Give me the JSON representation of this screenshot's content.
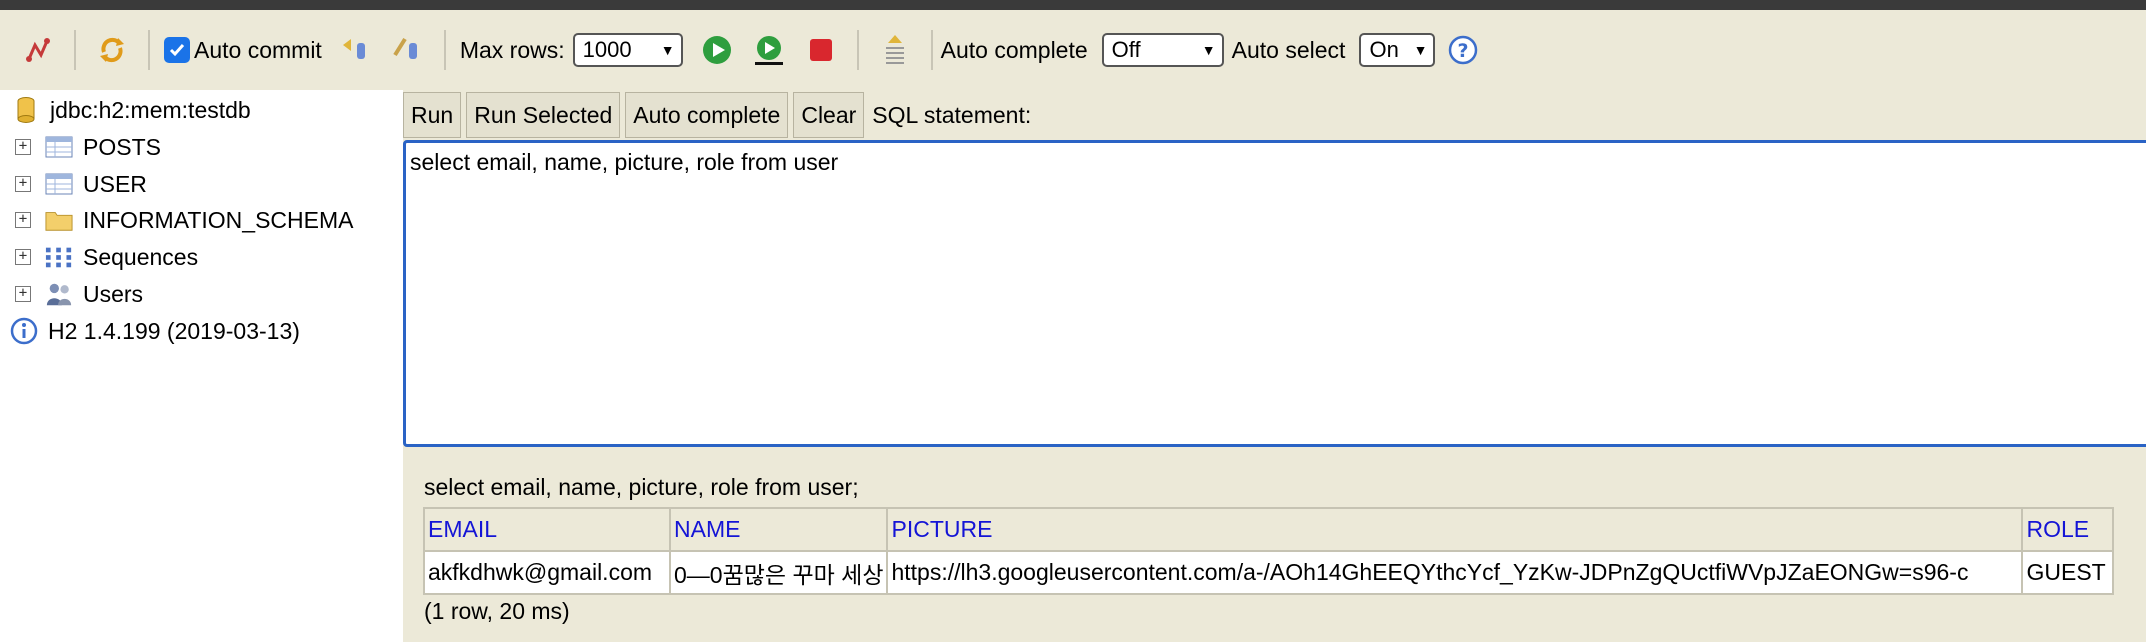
{
  "toolbar": {
    "auto_commit_label": "Auto commit",
    "max_rows_label": "Max rows:",
    "max_rows_value": "1000",
    "auto_complete_label": "Auto complete",
    "auto_complete_value": "Off",
    "auto_select_label": "Auto select",
    "auto_select_value": "On",
    "auto_commit_checked": true
  },
  "sidebar": {
    "connection": "jdbc:h2:mem:testdb",
    "items": [
      {
        "label": "POSTS",
        "icon": "table-icon"
      },
      {
        "label": "USER",
        "icon": "table-icon"
      },
      {
        "label": "INFORMATION_SCHEMA",
        "icon": "folder-icon"
      },
      {
        "label": "Sequences",
        "icon": "sequences-icon"
      },
      {
        "label": "Users",
        "icon": "users-icon"
      }
    ],
    "version": "H2 1.4.199 (2019-03-13)"
  },
  "buttons": {
    "run": "Run",
    "run_selected": "Run Selected",
    "auto_complete": "Auto complete",
    "clear": "Clear"
  },
  "sql_label": "SQL statement:",
  "editor_text": "select email, name, picture, role from user",
  "result": {
    "statement": "select email, name, picture, role from user;",
    "columns": [
      "EMAIL",
      "NAME",
      "PICTURE",
      "ROLE"
    ],
    "rows": [
      [
        "akfkdhwk@gmail.com",
        "0—0꿈많은 꾸마 세상",
        "https://lh3.googleusercontent.com/a-/AOh14GhEEQYthcYcf_YzKw-JDPnZgQUctfiWVpJZaEONGw=s96-c",
        "GUEST"
      ]
    ],
    "summary": "(1 row, 20 ms)"
  },
  "colors": {
    "panel": "#ece9d8",
    "accent": "#2a63c5",
    "header_text": "#1414d6",
    "stop": "#d9272e",
    "run": "#2e9e3e"
  }
}
